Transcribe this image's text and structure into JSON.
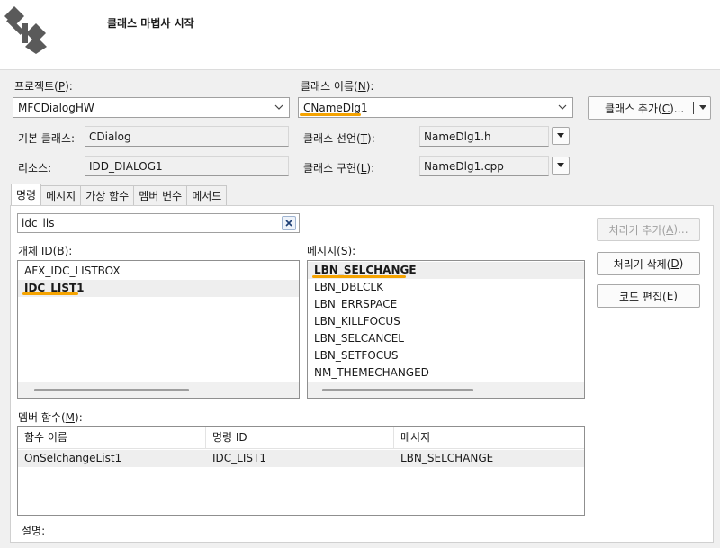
{
  "header": {
    "title": "클래스 마법사 시작"
  },
  "project": {
    "label": "프로젝트(",
    "accel": "P",
    "tail": "):",
    "value": "MFCDialogHW"
  },
  "class_name": {
    "label": "클래스 이름(",
    "accel": "N",
    "tail": "):",
    "value": "CNameDlg1"
  },
  "add_class_button": {
    "label_pre": "클래스 추가(",
    "accel": "C",
    "label_post": ")..."
  },
  "base_class": {
    "label": "기본 클래스:",
    "value": "CDialog"
  },
  "class_declaration": {
    "label_pre": "클래스 선언(",
    "accel": "T",
    "label_post": "):",
    "value": "NameDlg1.h"
  },
  "resource": {
    "label": "리소스:",
    "value": "IDD_DIALOG1"
  },
  "class_implementation": {
    "label_pre": "클래스 구현(",
    "accel": "L",
    "label_post": "):",
    "value": "NameDlg1.cpp"
  },
  "tabs": [
    "명령",
    "메시지",
    "가상 함수",
    "멤버 변수",
    "메서드"
  ],
  "search": {
    "value": "idc_lis"
  },
  "object_ids": {
    "label_pre": "개체 ID(",
    "accel": "B",
    "label_post": "):",
    "items": [
      "AFX_IDC_LISTBOX",
      "IDC_LIST1"
    ],
    "selected_index": 1
  },
  "messages": {
    "label_pre": "메시지(",
    "accel": "S",
    "label_post": "):",
    "items": [
      "LBN_SELCHANGE",
      "LBN_DBLCLK",
      "LBN_ERRSPACE",
      "LBN_KILLFOCUS",
      "LBN_SELCANCEL",
      "LBN_SETFOCUS",
      "NM_THEMECHANGED"
    ],
    "selected_index": 0
  },
  "buttons": {
    "add_handler": {
      "pre": "처리기 추가(",
      "accel": "A",
      "post": ")..."
    },
    "delete_handler": {
      "pre": "처리기 삭제(",
      "accel": "D",
      "post": ")"
    },
    "edit_code": {
      "pre": "코드 편집(",
      "accel": "E",
      "post": ")"
    }
  },
  "member_functions": {
    "label_pre": "멤버 함수(",
    "accel": "M",
    "label_post": "):",
    "columns": [
      "함수 이름",
      "명령 ID",
      "메시지"
    ],
    "rows": [
      [
        "OnSelchangeList1",
        "IDC_LIST1",
        "LBN_SELCHANGE"
      ]
    ]
  },
  "description": {
    "label": "설명:"
  },
  "colors": {
    "highlight_underline": "#f5a300",
    "selected_row": "#eeeeee"
  }
}
